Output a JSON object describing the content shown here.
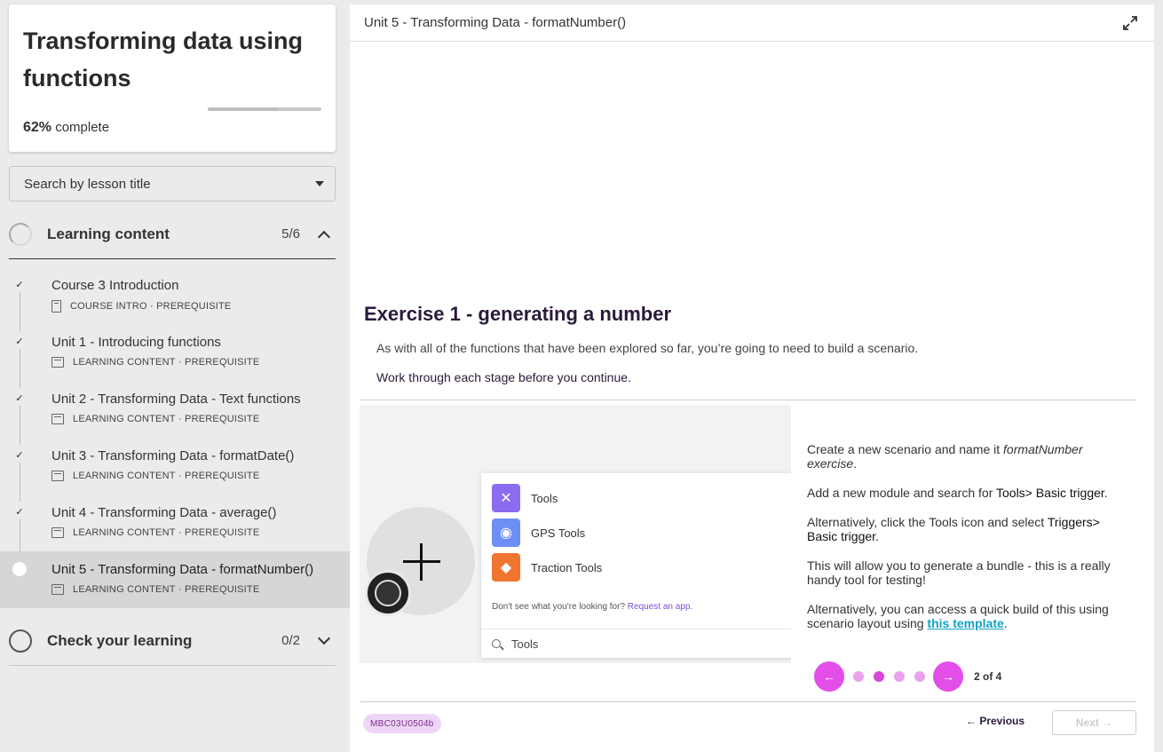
{
  "course": {
    "title": "Transforming data using functions",
    "progress_percent": 62,
    "progress_number": "62%",
    "progress_suffix": "complete"
  },
  "search": {
    "placeholder": "Search by lesson title"
  },
  "sections": [
    {
      "label": "Learning content",
      "count": "5/6",
      "expanded": true
    },
    {
      "label": "Check your learning",
      "count": "0/2",
      "expanded": false
    }
  ],
  "lessons": [
    {
      "title": "Course 3 Introduction",
      "type": "COURSE INTRO",
      "tag": "PREREQUISITE",
      "done": true
    },
    {
      "title": "Unit 1 - Introducing functions",
      "type": "LEARNING CONTENT",
      "tag": "PREREQUISITE",
      "done": true
    },
    {
      "title": "Unit 2 - Transforming Data - Text functions",
      "type": "LEARNING CONTENT",
      "tag": "PREREQUISITE",
      "done": true
    },
    {
      "title": "Unit 3 - Transforming Data - formatDate()",
      "type": "LEARNING CONTENT",
      "tag": "PREREQUISITE",
      "done": true
    },
    {
      "title": "Unit 4 - Transforming Data - average()",
      "type": "LEARNING CONTENT",
      "tag": "PREREQUISITE",
      "done": true
    },
    {
      "title": "Unit 5 - Transforming Data - formatNumber()",
      "type": "LEARNING CONTENT",
      "tag": "PREREQUISITE",
      "done": false,
      "active": true
    }
  ],
  "main": {
    "header_title": "Unit 5 - Transforming Data - formatNumber()",
    "exercise_title": "Exercise 1 - generating a number",
    "intro": "As with all of the functions that have been explored so far, you’re going to need to build a scenario.",
    "instruction": "Work through each stage before you continue."
  },
  "preview": {
    "menu_items": [
      {
        "label": "Tools",
        "color": "#8b6cf0"
      },
      {
        "label": "GPS Tools",
        "color": "#6f8ef5"
      },
      {
        "label": "Traction Tools",
        "color": "#f0762f"
      }
    ],
    "note_text": "Don't see what you're looking for? ",
    "note_link": "Request an app.",
    "search_text": "Tools"
  },
  "steps": {
    "p1_a": "Create a new scenario and name it ",
    "p1_em": "formatNumber exercise",
    "p1_b": ".",
    "p2_a": "Add a new module and search for ",
    "p2_strong": "Tools> Basic trigger",
    "p2_b": ".",
    "p3_a": "Alternatively, click the Tools icon and select ",
    "p3_strong": "Triggers> Basic trigger",
    "p3_b": ".",
    "p4": "This will allow you to generate a bundle - this is a really handy tool for testing!",
    "p5_a": "Alternatively, you can access a quick build of this using scenario layout using ",
    "p5_link": "this template",
    "p5_b": "."
  },
  "pager": {
    "label": "2 of 4",
    "current": 2,
    "total": 4,
    "prev_glyph": "←",
    "next_glyph": "→"
  },
  "footer": {
    "code": "MBC03U0504b",
    "previous_label": "← Previous",
    "next_label": "Next →"
  },
  "colors": {
    "accent": "#e44ee8",
    "title": "#2b1a3a",
    "link": "#14a0c8"
  }
}
